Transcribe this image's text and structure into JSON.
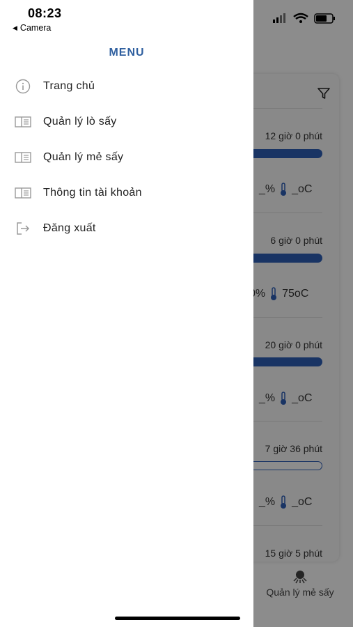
{
  "status_bar": {
    "time": "08:23",
    "back_label": "Camera"
  },
  "drawer": {
    "title": "MENU",
    "items": [
      {
        "label": "Trang chủ",
        "icon": "info-icon"
      },
      {
        "label": "Quản lý lò sấy",
        "icon": "book-icon"
      },
      {
        "label": "Quản lý mẻ sấy",
        "icon": "book-icon"
      },
      {
        "label": "Thông tin tài khoản",
        "icon": "book-icon"
      },
      {
        "label": "Đăng xuất",
        "icon": "logout-icon"
      }
    ]
  },
  "background": {
    "rows": [
      {
        "time": "12 giờ 0 phút",
        "progress": 1.0,
        "humidity": "_%",
        "temperature": "_oC"
      },
      {
        "time": "6 giờ 0 phút",
        "progress": 1.0,
        "humidity": "0%",
        "temperature": "75oC"
      },
      {
        "time": "20 giờ 0 phút",
        "progress": 1.0,
        "humidity": "_%",
        "temperature": "_oC"
      },
      {
        "time": "7 giờ 36 phút",
        "progress": 0.0,
        "humidity": "_%",
        "temperature": "_oC"
      },
      {
        "time": "15 giờ 5 phút"
      }
    ],
    "tab_label": "Quản lý mẻ sấy"
  },
  "colors": {
    "accent": "#2f5f9f",
    "progress": "#2f5fb7"
  }
}
